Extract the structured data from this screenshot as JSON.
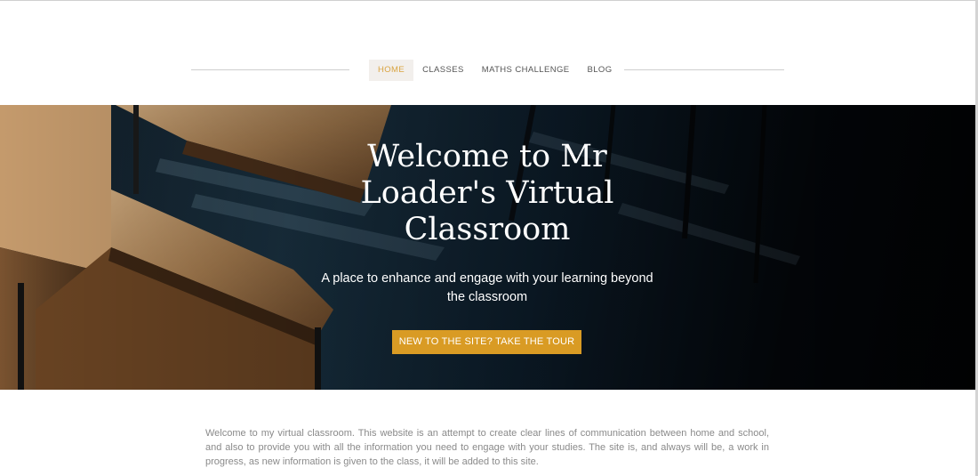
{
  "nav": {
    "items": [
      {
        "label": "HOME",
        "active": true
      },
      {
        "label": "CLASSES",
        "active": false
      },
      {
        "label": "MATHS CHALLENGE",
        "active": false
      },
      {
        "label": "BLOG",
        "active": false
      }
    ],
    "active_color": "#d9a441"
  },
  "hero": {
    "title": "Welcome to Mr Loader's Virtual Classroom",
    "subtitle": "A place to enhance and engage with your learning beyond the classroom",
    "button_label": "NEW TO THE SITE? TAKE THE TOUR",
    "button_color": "#d99b24"
  },
  "intro": {
    "text": "Welcome to my virtual classroom.  This website is an attempt to create clear lines of communication between home and school, and also to provide you with all the information you need to engage with your studies.  The site is, and always will be, a work in progress, as new information is given to the class, it will be added to this site."
  }
}
